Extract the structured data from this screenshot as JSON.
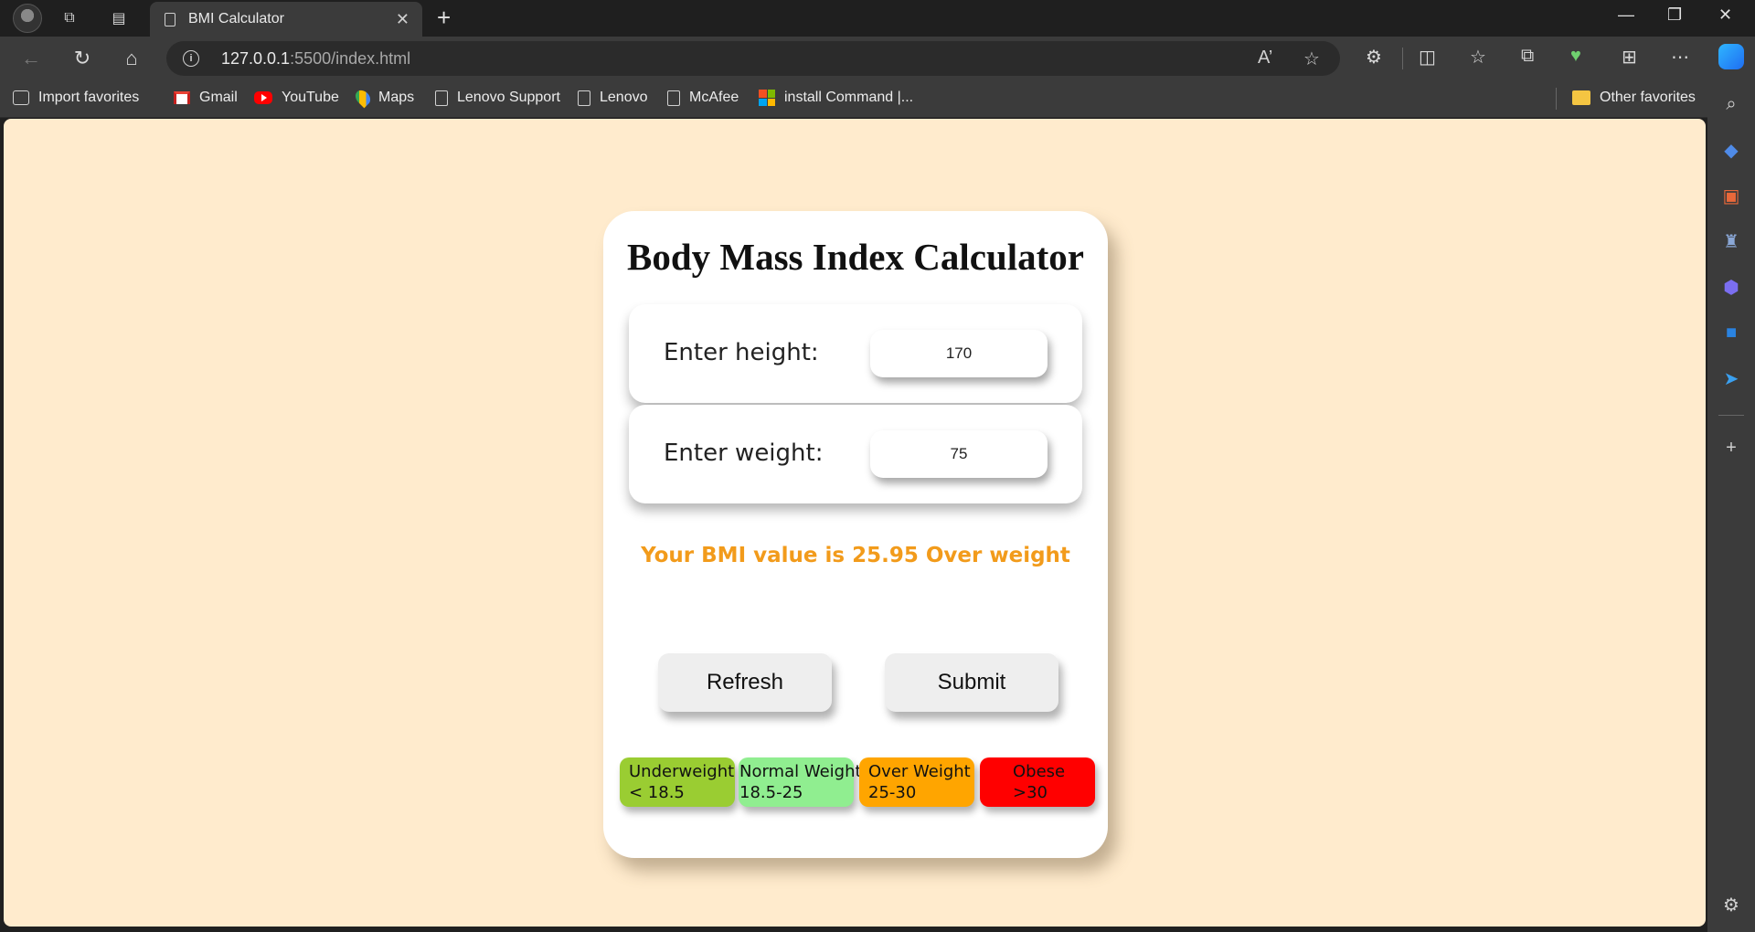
{
  "browser": {
    "tab_title": "BMI Calculator",
    "url_host": "127.0.0.1",
    "url_path": ":5500/index.html",
    "favorites": [
      {
        "label": "Import favorites",
        "icon": "import-icon"
      },
      {
        "label": "Gmail",
        "icon": "gmail-icon"
      },
      {
        "label": "YouTube",
        "icon": "youtube-icon"
      },
      {
        "label": "Maps",
        "icon": "maps-icon"
      },
      {
        "label": "Lenovo Support",
        "icon": "page-icon"
      },
      {
        "label": "Lenovo",
        "icon": "page-icon"
      },
      {
        "label": "McAfee",
        "icon": "page-icon"
      },
      {
        "label": "install Command |...",
        "icon": "microsoft-icon"
      }
    ],
    "other_favorites": "Other favorites"
  },
  "page": {
    "title": "Body Mass Index Calculator",
    "height_label": "Enter height:",
    "height_value": "170",
    "weight_label": "Enter weight:",
    "weight_value": "75",
    "result_text": "Your BMI value is 25.95 Over weight",
    "result_color": "#f29b1b",
    "refresh_label": "Refresh",
    "submit_label": "Submit",
    "categories": [
      {
        "name": "Underweight",
        "range": "< 18.5",
        "color": "#9acd32"
      },
      {
        "name": "Normal Weight",
        "range": "18.5-25",
        "color": "#90ee90"
      },
      {
        "name": "Over Weight",
        "range": "25-30",
        "color": "#ffa500"
      },
      {
        "name": "Obese",
        "range": ">30",
        "color": "#ff0000"
      }
    ],
    "background": "#ffebcd"
  }
}
